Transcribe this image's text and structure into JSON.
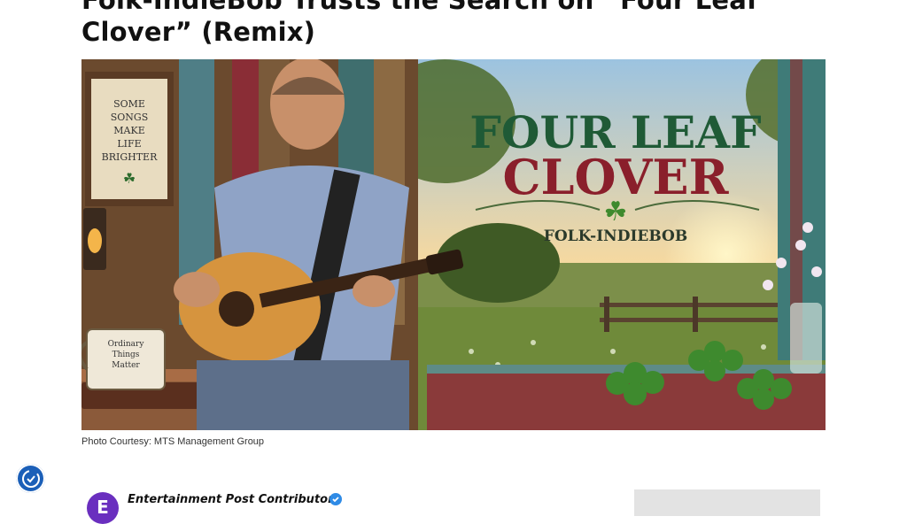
{
  "article": {
    "title": "Folk-IndieBob Trusts the Search on “Four Leaf Clover” (Remix)",
    "photo_credit": "Photo Courtesy: MTS Management Group"
  },
  "hero_art": {
    "title_line1": "FOUR LEAF",
    "title_line2": "CLOVER",
    "artist": "FOLK-INDIEBOB",
    "sign_lines": [
      "SOME",
      "SONGS",
      "MAKE",
      "LIFE",
      "BRIGHTER"
    ],
    "mug_lines": [
      "Ordinary",
      "Things",
      "Matter"
    ]
  },
  "author": {
    "name": "Entertainment Post Contributor",
    "avatar_letter": "E"
  },
  "accessibility": {
    "icon": "accessibility-icon"
  },
  "colors": {
    "title_green": "#1f5a36",
    "title_red": "#8a1f2b",
    "accent_blue": "#1b5fb8",
    "avatar_purple": "#6a2fbf"
  }
}
